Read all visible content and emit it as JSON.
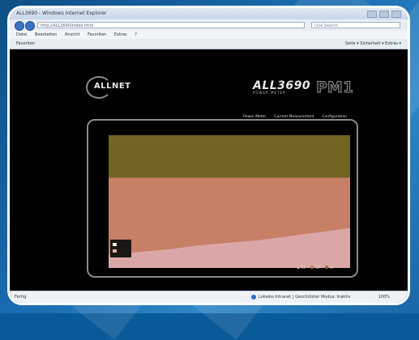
{
  "window": {
    "title": "ALL3690 - Windows Internet Explorer"
  },
  "nav": {
    "address": "http://ALL3690/index.html",
    "search_placeholder": "Live Search"
  },
  "menu": {
    "items": [
      "Datei",
      "Bearbeiten",
      "Ansicht",
      "Favoriten",
      "Extras",
      "?"
    ]
  },
  "favorites": {
    "label": "Favoriten",
    "tools": "Seite ▾  Sicherheit ▾  Extras ▾"
  },
  "page": {
    "brand": "ALLNET",
    "product_model": "ALL3690",
    "product_sub": "POWER METER",
    "product_suffix": "PM1",
    "links": [
      "Power Meter",
      "Current Measurement",
      "Configuration"
    ]
  },
  "chart_data": {
    "type": "area",
    "series": [
      {
        "name": "L1",
        "color": "#dba7a6",
        "values": [
          10,
          12,
          14,
          17,
          19,
          21,
          24,
          27,
          30
        ]
      },
      {
        "name": "L2",
        "color": "#c77f66",
        "values": [
          68,
          68,
          68,
          68,
          68,
          68,
          68,
          68,
          68
        ]
      },
      {
        "name": "L3",
        "color": "#8b7a2a",
        "values": [
          100,
          100,
          100,
          100,
          100,
          100,
          100,
          100,
          100
        ]
      }
    ],
    "ylim": [
      0,
      100
    ],
    "legend_placement": "bottom-right"
  },
  "status": {
    "left": "Fertig",
    "zone": "Lokales Intranet | Geschützter Modus: Inaktiv",
    "zoom": "100%"
  },
  "colors": {
    "frame": "#ffffff",
    "background": "#0e5a98"
  }
}
